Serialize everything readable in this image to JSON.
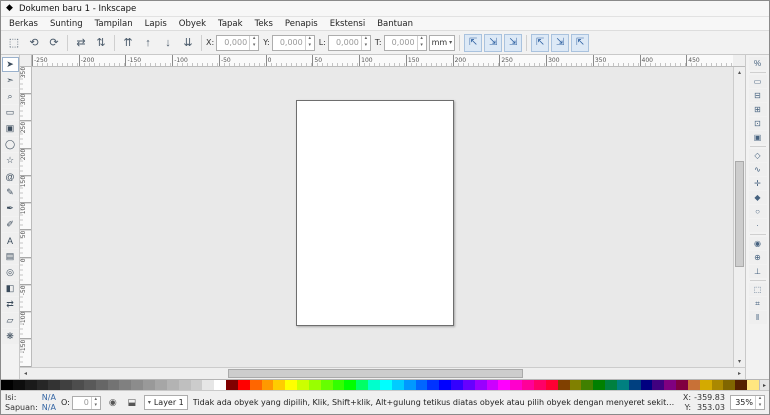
{
  "window": {
    "title": "Dokumen baru 1 - Inkscape",
    "app_icon": "◆"
  },
  "menubar": {
    "items": [
      "Berkas",
      "Sunting",
      "Tampilan",
      "Lapis",
      "Obyek",
      "Tapak",
      "Teks",
      "Penapis",
      "Ekstensi",
      "Bantuan"
    ]
  },
  "toolbar": {
    "icons": [
      {
        "name": "select-all-button",
        "glyph": "⬚"
      },
      {
        "name": "rotate-90-ccw-button",
        "glyph": "⟲"
      },
      {
        "name": "rotate-90-cw-button",
        "glyph": "⟳"
      },
      {
        "sep": true
      },
      {
        "name": "flip-horizontal-button",
        "glyph": "⇄"
      },
      {
        "name": "flip-vertical-button",
        "glyph": "⇅"
      },
      {
        "sep": true
      },
      {
        "name": "raise-to-top-button",
        "glyph": "⇈"
      },
      {
        "name": "raise-button",
        "glyph": "↑"
      },
      {
        "name": "lower-button",
        "glyph": "↓"
      },
      {
        "name": "lower-to-bottom-button",
        "glyph": "⇊"
      }
    ],
    "fields": [
      {
        "label": "X:",
        "value": "0,000"
      },
      {
        "label": "Y:",
        "value": "0,000"
      },
      {
        "label": "L:",
        "value": "0,000"
      },
      {
        "label": "T:",
        "value": "0,000"
      }
    ],
    "unit": "mm",
    "toggles": [
      {
        "name": "scale-stroke-toggle",
        "glyph": "⇱"
      },
      {
        "name": "scale-corners-toggle",
        "glyph": "⇲"
      },
      {
        "name": "transform-gradient-toggle",
        "glyph": "⇲"
      },
      {
        "sep": true
      },
      {
        "name": "transform-pattern-toggle",
        "glyph": "⇱"
      },
      {
        "name": "move-as-group-toggle",
        "glyph": "⇲"
      },
      {
        "name": "bounding-box-toggle",
        "glyph": "⇱"
      }
    ]
  },
  "toolbox": {
    "tools": [
      {
        "name": "selector-tool",
        "glyph": "➤"
      },
      {
        "name": "node-tool",
        "glyph": "➣"
      },
      {
        "name": "zoom-tool",
        "glyph": "⌕"
      },
      {
        "name": "rectangle-tool",
        "glyph": "▭"
      },
      {
        "name": "box-3d-tool",
        "glyph": "▣"
      },
      {
        "name": "ellipse-tool",
        "glyph": "◯"
      },
      {
        "name": "star-tool",
        "glyph": "☆"
      },
      {
        "name": "spiral-tool",
        "glyph": "@"
      },
      {
        "name": "pencil-tool",
        "glyph": "✎"
      },
      {
        "name": "pen-tool",
        "glyph": "✒"
      },
      {
        "name": "calligraphy-tool",
        "glyph": "✐"
      },
      {
        "name": "text-tool",
        "glyph": "A"
      },
      {
        "name": "gradient-tool",
        "glyph": "▤"
      },
      {
        "name": "dropper-tool",
        "glyph": "◎"
      },
      {
        "name": "fill-tool",
        "glyph": "◧"
      },
      {
        "name": "connector-tool",
        "glyph": "⇄"
      },
      {
        "name": "eraser-tool",
        "glyph": "▱"
      },
      {
        "name": "tweak-tool",
        "glyph": "❋"
      }
    ]
  },
  "snapbar": {
    "items": [
      {
        "name": "snap-enable",
        "glyph": "%"
      },
      {
        "sep": true
      },
      {
        "name": "snap-bbox",
        "glyph": "▭"
      },
      {
        "name": "snap-bbox-edges",
        "glyph": "⊟"
      },
      {
        "name": "snap-bbox-corners",
        "glyph": "⊞"
      },
      {
        "name": "snap-bbox-edge-midpoints",
        "glyph": "⊡"
      },
      {
        "name": "snap-bbox-centers",
        "glyph": "▣"
      },
      {
        "sep": true
      },
      {
        "name": "snap-nodes",
        "glyph": "◇"
      },
      {
        "name": "snap-paths",
        "glyph": "∿"
      },
      {
        "name": "snap-path-intersections",
        "glyph": "✛"
      },
      {
        "name": "snap-cusp-nodes",
        "glyph": "◆"
      },
      {
        "name": "snap-smooth-nodes",
        "glyph": "○"
      },
      {
        "name": "snap-midpoints",
        "glyph": "·"
      },
      {
        "sep": true
      },
      {
        "name": "snap-object-centers",
        "glyph": "◉"
      },
      {
        "name": "snap-rotation-centers",
        "glyph": "⊕"
      },
      {
        "name": "snap-text-baseline",
        "glyph": "⊥"
      },
      {
        "sep": true
      },
      {
        "name": "snap-page-border",
        "glyph": "⬚"
      },
      {
        "name": "snap-grids",
        "glyph": "⌗"
      },
      {
        "name": "snap-guides",
        "glyph": "‖"
      }
    ]
  },
  "rulers": {
    "top": [
      "-250",
      "-200",
      "-150",
      "-100",
      "-50",
      "0",
      "50",
      "100",
      "150",
      "200",
      "250",
      "300",
      "350",
      "400",
      "450"
    ],
    "left": [
      "350",
      "300",
      "250",
      "200",
      "150",
      "100",
      "50",
      "0",
      "-50",
      "-100",
      "-150"
    ]
  },
  "palette": {
    "colors": [
      "#000000",
      "#0d0d0d",
      "#1a1a1a",
      "#262626",
      "#333333",
      "#404040",
      "#4d4d4d",
      "#595959",
      "#666666",
      "#737373",
      "#808080",
      "#8c8c8c",
      "#999999",
      "#a6a6a6",
      "#b3b3b3",
      "#bfbfbf",
      "#cccccc",
      "#e6e6e6",
      "#ffffff",
      "#800000",
      "#ff0000",
      "#ff6600",
      "#ff9900",
      "#ffcc00",
      "#ffff00",
      "#ccff00",
      "#99ff00",
      "#66ff00",
      "#33ff00",
      "#00ff00",
      "#00ff66",
      "#00ffcc",
      "#00ffff",
      "#00ccff",
      "#0099ff",
      "#0066ff",
      "#0033ff",
      "#0000ff",
      "#3300ff",
      "#6600ff",
      "#9900ff",
      "#cc00ff",
      "#ff00ff",
      "#ff00cc",
      "#ff0099",
      "#ff0066",
      "#ff0033",
      "#804000",
      "#808000",
      "#408000",
      "#008000",
      "#008040",
      "#008080",
      "#004080",
      "#000080",
      "#400080",
      "#800080",
      "#800040",
      "#c87137",
      "#d4aa00",
      "#aa8800",
      "#806600",
      "#552200",
      "#ffe680"
    ],
    "scroll_right": "▸"
  },
  "statusbar": {
    "fill_label": "Isi:",
    "fill_value": "N/A",
    "stroke_label": "Sapuan:",
    "stroke_value": "N/A",
    "opacity_label": "O:",
    "opacity_value": "0",
    "layer_name": "Layer 1",
    "message": "Tidak ada obyek yang dipilih, Klik, Shift+klik, Alt+gulung tetikus diatas obyek atau pilih obyek dengan menyeret sekitar obyek",
    "x_label": "X:",
    "x_value": "-359.83",
    "y_label": "Y:",
    "y_value": "353.03",
    "zoom_value": "35%"
  }
}
